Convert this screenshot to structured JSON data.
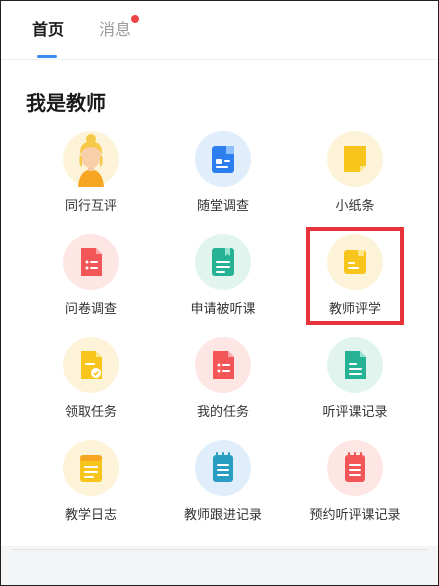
{
  "tabs": {
    "home": "首页",
    "messages": "消息"
  },
  "section_title": "我是教师",
  "items": [
    {
      "label": "同行互评",
      "icon": "teacher-avatar-icon"
    },
    {
      "label": "随堂调查",
      "icon": "clipboard-icon"
    },
    {
      "label": "小纸条",
      "icon": "sticky-note-icon"
    },
    {
      "label": "问卷调查",
      "icon": "questionnaire-icon"
    },
    {
      "label": "申请被听课",
      "icon": "bookmark-note-icon"
    },
    {
      "label": "教师评学",
      "icon": "evaluation-folder-icon"
    },
    {
      "label": "领取任务",
      "icon": "task-check-icon"
    },
    {
      "label": "我的任务",
      "icon": "task-list-icon"
    },
    {
      "label": "听评课记录",
      "icon": "record-document-icon"
    },
    {
      "label": "教学日志",
      "icon": "teaching-log-icon"
    },
    {
      "label": "教师跟进记录",
      "icon": "follow-up-notepad-icon"
    },
    {
      "label": "预约听评课记录",
      "icon": "appointment-notepad-icon"
    }
  ],
  "colors": {
    "accent_blue": "#3a8ef0",
    "badge_red": "#f04545",
    "highlight_red": "#e7343b"
  }
}
